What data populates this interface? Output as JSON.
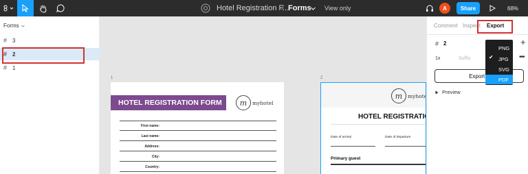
{
  "toolbar": {
    "file_name": "Hotel Registration F...",
    "separator": "/",
    "page_name": "Forms",
    "view_mode": "View only",
    "avatar_initial": "A",
    "share_label": "Share",
    "zoom": "68%"
  },
  "layers_panel": {
    "header": "Forms",
    "items": [
      {
        "label": "3",
        "selected": false
      },
      {
        "label": "2",
        "selected": true
      },
      {
        "label": "1",
        "selected": false
      }
    ]
  },
  "canvas": {
    "frame1": {
      "label": "1",
      "title": "HOTEL REGISTRATION FORM",
      "logo_text": "myhotel",
      "fields": [
        "First name:",
        "Last name:",
        "Address:",
        "City:",
        "Country:"
      ]
    },
    "frame2": {
      "label": "2",
      "title": "HOTEL REGISTRATIO",
      "logo_text": "myhotel",
      "date_arrival": "Date of arrival",
      "date_departure": "Date of departure",
      "primary_guest": "Primary guest"
    }
  },
  "right_panel": {
    "tabs": [
      "Comment",
      "Inspect",
      "Export"
    ],
    "active_tab": "Export",
    "frame_name": "2",
    "scale": "1x",
    "suffix_placeholder": "Suffix",
    "more": "•••",
    "export_button": "Export 2",
    "preview_label": "Preview"
  },
  "format_dropdown": {
    "options": [
      "PNG",
      "JPG",
      "SVG",
      "PDF"
    ],
    "checked": "JPG",
    "highlighted": "PDF"
  },
  "colors": {
    "accent": "#18a0fb",
    "toolbar": "#2c2c2c",
    "highlight_box": "#d32f2f",
    "banner": "#7d4a8f",
    "avatar": "#f24e1e"
  }
}
